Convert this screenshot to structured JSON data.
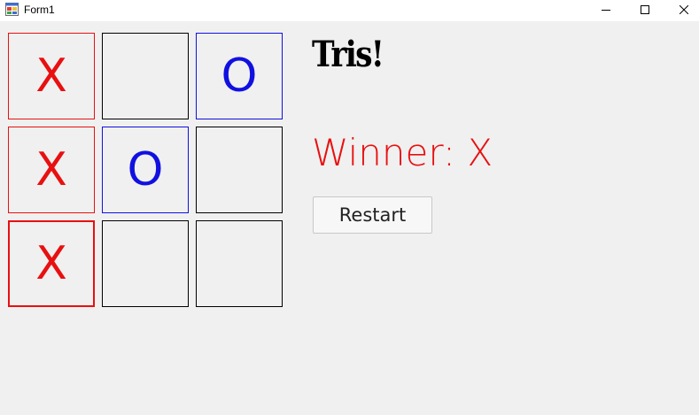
{
  "window": {
    "title": "Form1",
    "icon": "form-app-icon",
    "controls": [
      "minimize-icon",
      "maximize-icon",
      "close-icon"
    ]
  },
  "board": {
    "cells": [
      {
        "mark": "X",
        "player": "x"
      },
      {
        "mark": "",
        "player": ""
      },
      {
        "mark": "O",
        "player": "o"
      },
      {
        "mark": "X",
        "player": "x"
      },
      {
        "mark": "O",
        "player": "o"
      },
      {
        "mark": "",
        "player": ""
      },
      {
        "mark": "X",
        "player": "x"
      },
      {
        "mark": "",
        "player": ""
      },
      {
        "mark": "",
        "player": ""
      }
    ],
    "colors": {
      "x": "#e81010",
      "o": "#1010e0",
      "empty": "#000000"
    }
  },
  "game": {
    "title": "Tris!",
    "status": "Winner: X",
    "restart_label": "Restart"
  }
}
